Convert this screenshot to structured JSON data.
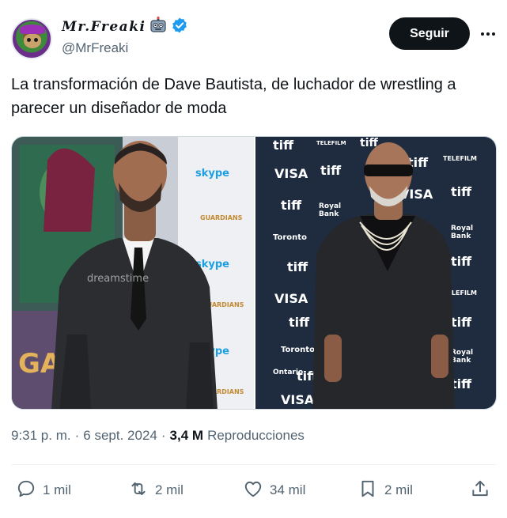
{
  "author": {
    "display_name": "Mr.Freaki",
    "handle": "@MrFreaki",
    "name_emoji": "robot-icon",
    "verified_icon": "verified-badge-icon"
  },
  "header": {
    "follow_label": "Seguir",
    "more_icon": "more-icon"
  },
  "tweet": {
    "text": "La transformación de Dave Bautista, de luchador de wrestling a parecer un diseñador de moda"
  },
  "media": {
    "left_photo": {
      "description_icon": "photo-left",
      "poster_text": "GUARDIANS GALAXY",
      "poster_text_bottom": "GALAXY",
      "sponsor": "skype",
      "watermark": "dreamstime"
    },
    "right_photo": {
      "description_icon": "photo-right",
      "backdrop_logos": [
        "tiff",
        "VISA",
        "TELEFILM",
        "Royal Bank",
        "Ontario"
      ]
    }
  },
  "meta": {
    "time": "9:31 p. m.",
    "separator": "·",
    "date": "6 sept. 2024",
    "views_count": "3,4 M",
    "views_label": "Reproducciones"
  },
  "actions": {
    "replies": "1 mil",
    "reposts": "2 mil",
    "likes": "34 mil",
    "bookmarks": "2 mil"
  },
  "colors": {
    "text_primary": "#0f1419",
    "text_secondary": "#536471",
    "verified": "#1d9bf0",
    "button_bg": "#0f1419"
  }
}
